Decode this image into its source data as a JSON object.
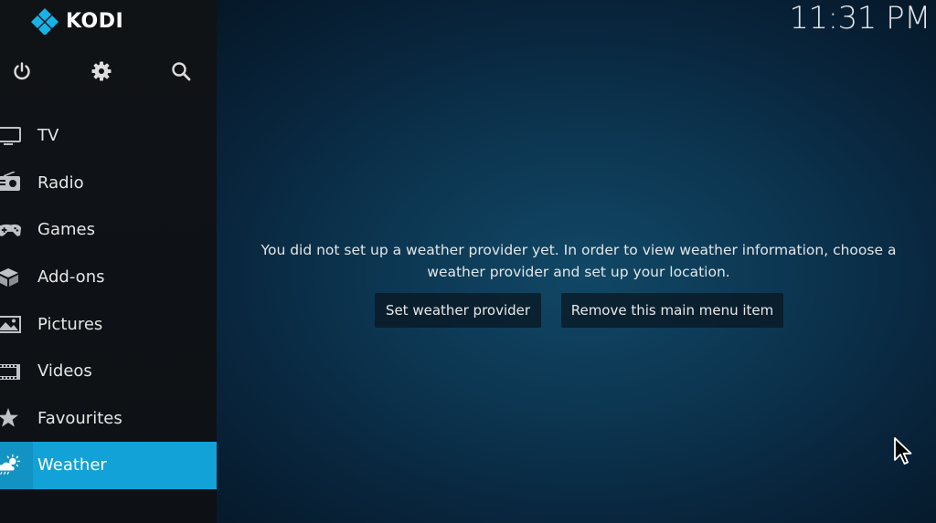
{
  "app": {
    "brand": "KODI",
    "clock": "11:31 PM"
  },
  "top_icons": [
    {
      "name": "power-icon"
    },
    {
      "name": "gear-icon"
    },
    {
      "name": "search-icon"
    }
  ],
  "menu": {
    "items": [
      {
        "label": "TV",
        "icon": "tv-icon",
        "active": false
      },
      {
        "label": "Radio",
        "icon": "radio-icon",
        "active": false
      },
      {
        "label": "Games",
        "icon": "gamepad-icon",
        "active": false
      },
      {
        "label": "Add-ons",
        "icon": "addons-box-icon",
        "active": false
      },
      {
        "label": "Pictures",
        "icon": "pictures-icon",
        "active": false
      },
      {
        "label": "Videos",
        "icon": "film-icon",
        "active": false
      },
      {
        "label": "Favourites",
        "icon": "star-icon",
        "active": false
      },
      {
        "label": "Weather",
        "icon": "weather-icon",
        "active": true
      }
    ]
  },
  "main": {
    "message": "You did not set up a weather provider yet. In order to view weather information, choose a weather provider and set up your location.",
    "buttons": {
      "set_provider": "Set weather provider",
      "remove_item": "Remove this main menu item"
    }
  },
  "colors": {
    "accent": "#12a2d7",
    "sidebar_bg": "#101316",
    "background": "#0c3550"
  }
}
